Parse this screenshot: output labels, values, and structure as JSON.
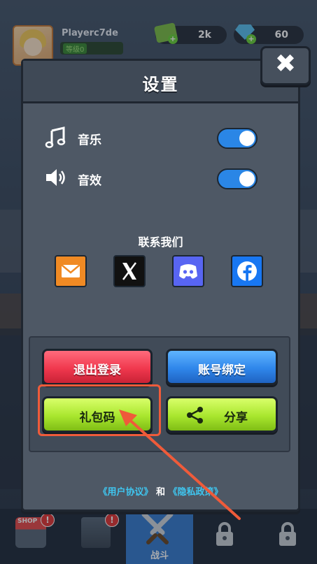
{
  "player": {
    "name": "Playerc7de",
    "level": "等级0"
  },
  "currency": {
    "cash": "2k",
    "gems": "60"
  },
  "dialog": {
    "title": "设置",
    "close_label": "✖",
    "settings": [
      {
        "label": "音乐",
        "icon": "music-note-icon",
        "on": true
      },
      {
        "label": "音效",
        "icon": "speaker-icon",
        "on": true
      }
    ],
    "contact_title": "联系我们",
    "contacts": [
      {
        "name": "email",
        "color": "#f08a24"
      },
      {
        "name": "x",
        "color": "#111111"
      },
      {
        "name": "discord",
        "color": "#5865f2"
      },
      {
        "name": "facebook",
        "color": "#1877f2"
      }
    ],
    "buttons": {
      "logout": "退出登录",
      "bind_account": "账号绑定",
      "gift_code": "礼包码",
      "share": "分享"
    },
    "policy": {
      "user_agreement": "《用户协议》",
      "and": "和",
      "privacy_policy": "《隐私政策》"
    }
  },
  "nav": {
    "shop_label": "SHOP",
    "battle_label": "战斗",
    "alert_mark": "!"
  }
}
